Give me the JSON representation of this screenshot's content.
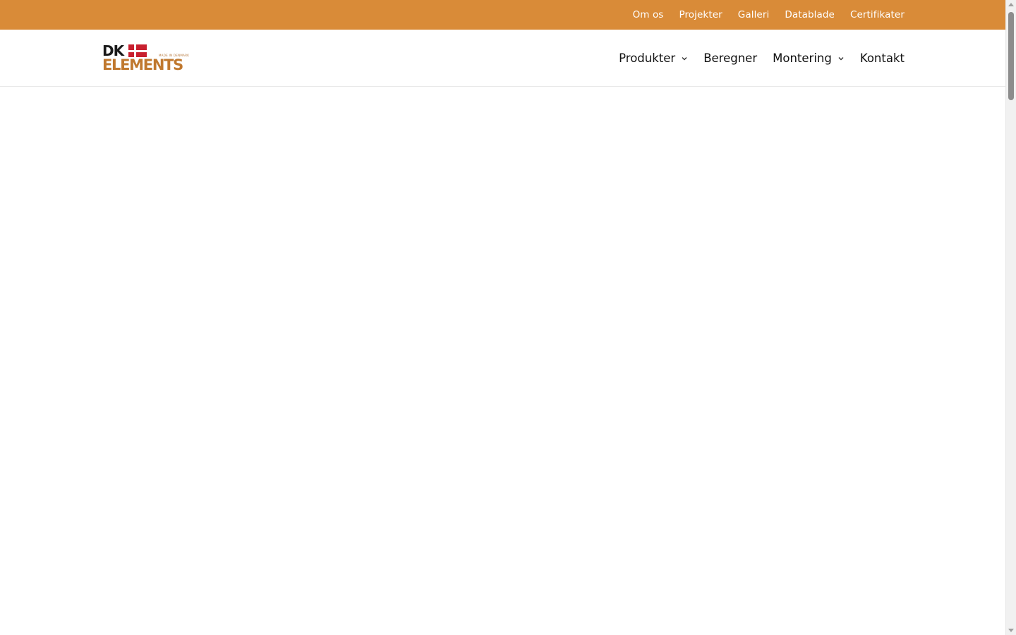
{
  "topbar": {
    "links": [
      "Om os",
      "Projekter",
      "Galleri",
      "Datablade",
      "Certifikater"
    ],
    "color": "#d98b38"
  },
  "logo": {
    "dk": "DK",
    "elements": "ELEMENTS",
    "tagline": "MADE IN DENMARK",
    "text_color": "#1a1a1a",
    "accent_color": "#c0782e",
    "flag_color": "#c8202f"
  },
  "nav": {
    "items": [
      {
        "label": "Produkter",
        "has_dropdown": true
      },
      {
        "label": "Beregner",
        "has_dropdown": false
      },
      {
        "label": "Montering",
        "has_dropdown": true
      },
      {
        "label": "Kontakt",
        "has_dropdown": false
      }
    ]
  },
  "icons": {
    "dropdown": "chevron-down-icon",
    "flag": "danish-flag-icon",
    "scroll_up": "arrow-up-icon",
    "scroll_down": "arrow-down-icon"
  }
}
